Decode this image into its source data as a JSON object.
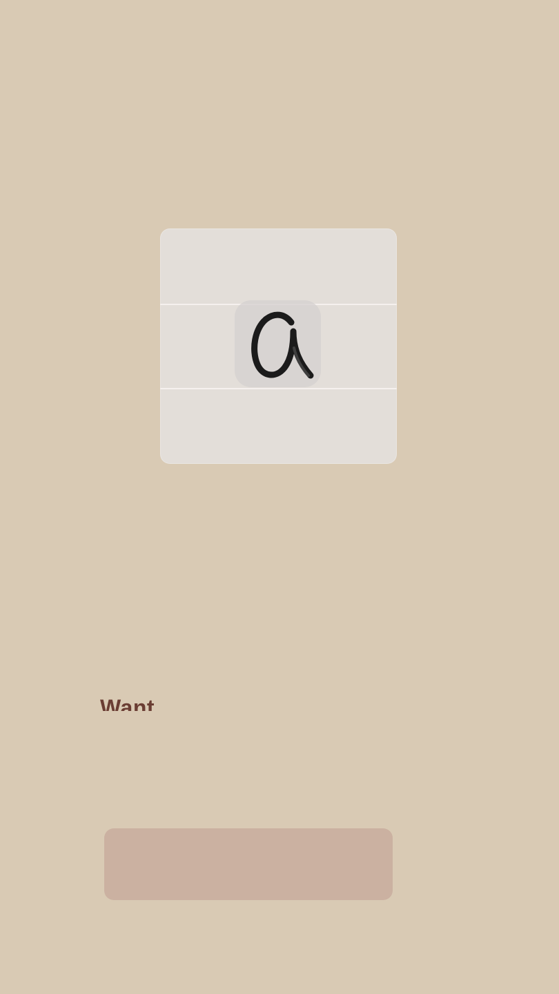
{
  "content": {
    "subtitle": "Want"
  },
  "icons": {
    "handwriting_example": "handwritten-a-icon"
  },
  "colors": {
    "background": "#d9cab4",
    "card": "#e3ded9",
    "subtitle": "#6a3d33",
    "button": "#cbb1a1",
    "ink": "#1b1b1b"
  }
}
